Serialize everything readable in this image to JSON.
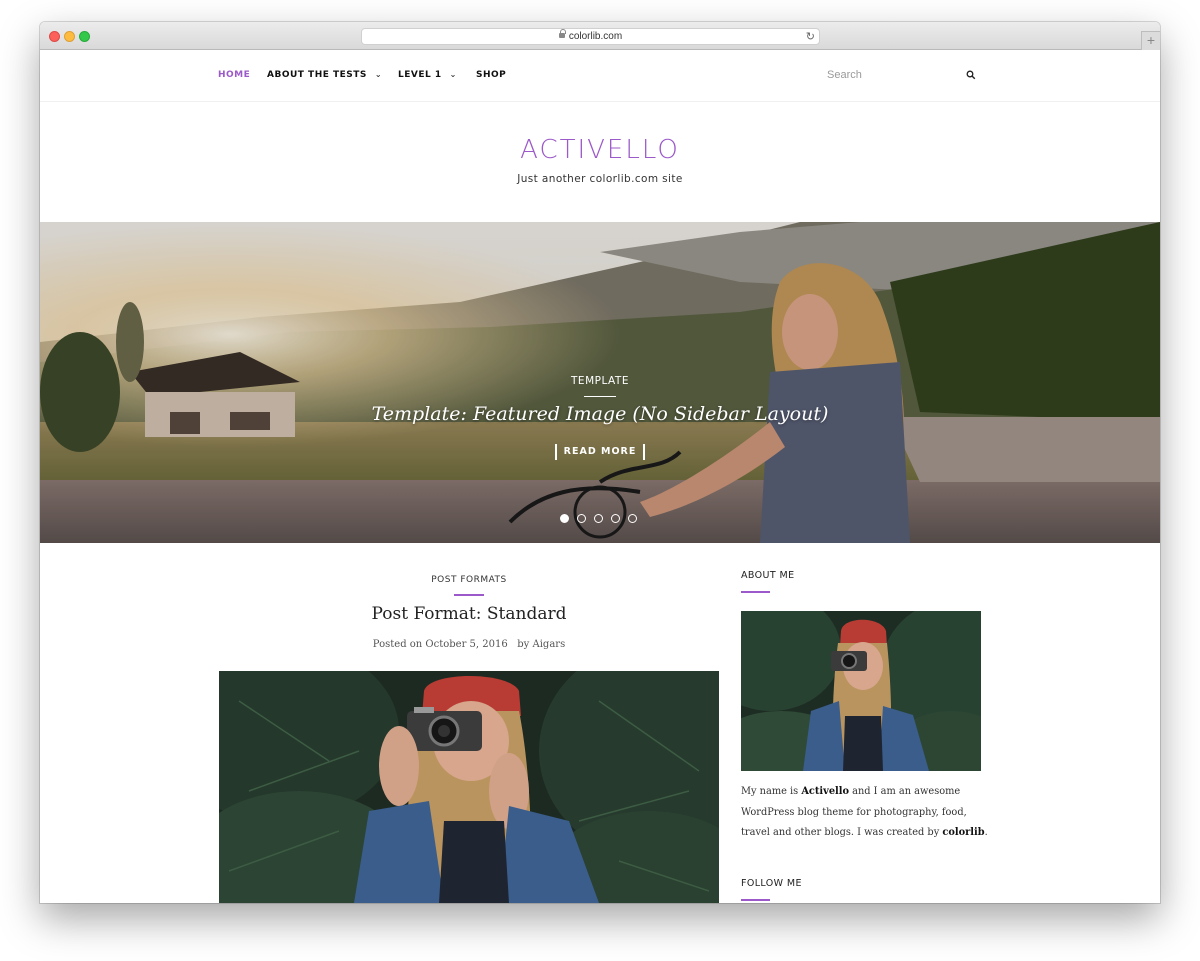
{
  "browser": {
    "url": "colorlib.com",
    "new_tab_symbol": "+"
  },
  "nav": {
    "items": [
      {
        "label": "HOME",
        "active": true,
        "has_dropdown": false
      },
      {
        "label": "ABOUT THE TESTS",
        "active": false,
        "has_dropdown": true
      },
      {
        "label": "LEVEL 1",
        "active": false,
        "has_dropdown": true
      },
      {
        "label": "SHOP",
        "active": false,
        "has_dropdown": false
      }
    ],
    "search_placeholder": "Search",
    "search_value": ""
  },
  "header": {
    "site_title": "ACTIVELLO",
    "tagline": "Just another colorlib.com site"
  },
  "hero": {
    "category": "TEMPLATE",
    "title": "Template: Featured Image (No Sidebar Layout)",
    "button": "READ MORE",
    "slide_count": 5,
    "active_slide": 1
  },
  "post": {
    "category": "POST FORMATS",
    "title": "Post Format: Standard",
    "posted_on_label": "Posted on",
    "date": "October 5, 2016",
    "by_label": "by",
    "author": "Aigars"
  },
  "sidebar": {
    "about_title": "ABOUT ME",
    "about_text_1": "My name is ",
    "about_name": "Activello",
    "about_text_2": " and I am an awesome WordPress blog theme for photography, food, travel and other blogs. I was created by ",
    "about_creator": "colorlib",
    "about_text_3": ".",
    "follow_title": "FOLLOW ME"
  },
  "colors": {
    "accent": "#9b59c9",
    "text": "#222222"
  },
  "icons": {
    "search": "search-icon",
    "caret": "chevron-down-icon",
    "lock": "lock-icon",
    "reload": "reload-icon"
  }
}
